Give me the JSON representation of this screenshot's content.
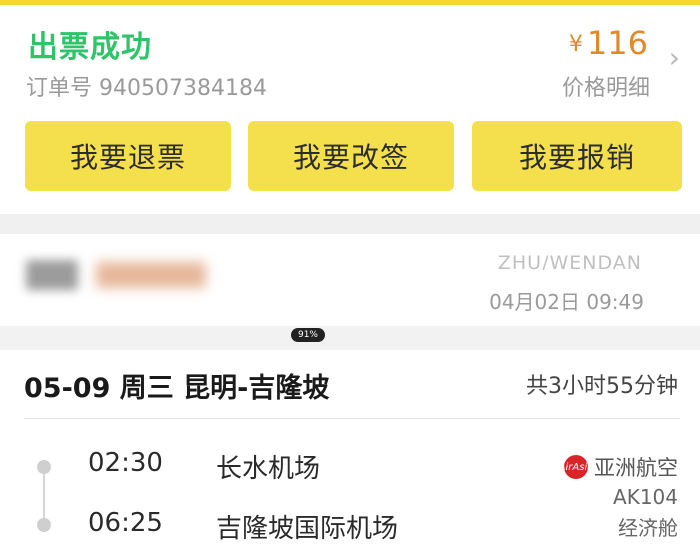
{
  "order": {
    "status": "出票成功",
    "number_label": "订单号 940507384184",
    "price_currency": "¥",
    "price": "116",
    "price_detail_label": "价格明细"
  },
  "actions": {
    "refund": "我要退票",
    "change": "我要改签",
    "reimburse": "我要报销"
  },
  "passenger": {
    "pinyin": "ZHU/WENDAN",
    "time": "04月02日 09:49"
  },
  "indicator": "91%",
  "flight": {
    "title": "05-09 周三 昆明-吉隆坡",
    "duration": "共3小时55分钟",
    "depart_time": "02:30",
    "depart_airport": "长水机场",
    "arrive_time": "06:25",
    "arrive_airport": "吉隆坡国际机场",
    "airline": "亚洲航空",
    "airline_logo_text": "AirAsia",
    "flight_no": "AK104",
    "cabin": "经济舱"
  }
}
